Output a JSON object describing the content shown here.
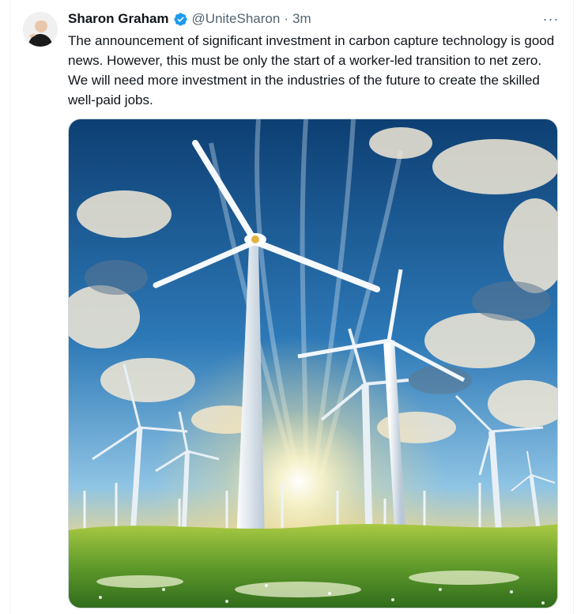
{
  "tweet": {
    "author_name": "Sharon Graham",
    "handle": "@UniteSharon",
    "separator": "·",
    "timestamp": "3m",
    "more_label": "···",
    "text": "The announcement of significant investment in carbon capture technology is good news. However, this must be only the start of a worker-led transition to net zero. We will need more investment in the industries of the future to create the skilled well-paid jobs.",
    "verified_color": "#1d9bf0"
  },
  "icons": {
    "verified": "verified-badge-icon",
    "more": "more-options-icon"
  },
  "media": {
    "alt": "wind turbines on grassy hills under a dramatic sunlit sky"
  }
}
